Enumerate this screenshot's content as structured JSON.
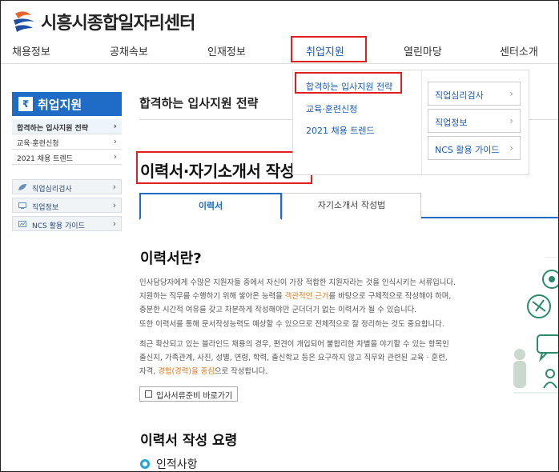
{
  "site": {
    "name": "시흥시종합일자리센터"
  },
  "gnb": [
    "채용정보",
    "공채속보",
    "인재정보",
    "취업지원",
    "열린마당",
    "센터소개"
  ],
  "dropdown": {
    "links": [
      "합격하는 입사지원 전략",
      "교육·훈련신청",
      "2021 채용 트렌드"
    ],
    "boxes": [
      "직업심리검사",
      "직업정보",
      "NCS 활용 가이드"
    ]
  },
  "sidebar": {
    "title": "취업지원",
    "items": [
      "합격하는 입사지원 전략",
      "교육·훈련신청",
      "2021 채용 트렌드"
    ],
    "subs": [
      "직업심리검사",
      "직업정보",
      "NCS 활용 가이드"
    ]
  },
  "main": {
    "sub_title": "합격하는 입사지원 전략",
    "page_title": "이력서·자기소개서 작성",
    "tabs": [
      "이력서",
      "자기소개서 작성법"
    ],
    "section_title": "이력서란?",
    "p1": {
      "l1": "인사담당자에게 수많은 지원자들 중에서 자신이 가장 적합한 지원자라는 것을 인식시키는 서류입니다.",
      "l2a": "지원하는 직무를 수행하기 위해 쌓아온 능력을 ",
      "l2h": "객관적인 근거",
      "l2b": "를 바탕으로 구체적으로 작성해야 하며,",
      "l3": "충분한 시간적 여유를 갖고 차분하게 작성해야만 군더더기 없는 이력서가 될 수 있습니다.",
      "l4": "또한 이력서를 통해 문서작성능력도 예상할 수 있으므로 전체적으로 잘 정리하는 것도 중요합니다."
    },
    "p2": {
      "l1": "최근 확산되고 있는 블라인드 채용의 경우, 편견이 개입되어 불합리한 차별을 야기할 수 있는 항목인",
      "l2": "출신지, 가족관계, 사진, 성별, 연령, 학력, 출신학교 등은 요구하지 않고 직무와 관련된 교육 · 훈련,",
      "l3a": "자격, ",
      "l3h": "경험(경력)을 중심",
      "l3b": "으로 작성합니다."
    },
    "link_button": "입사서류준비 바로가기",
    "section_title2": "이력서 작성 요령",
    "bullet_title": "인적사항"
  },
  "colors": {
    "accent": "#1e6cc6",
    "highlight": "#e07a1f",
    "annotation": "#e02020"
  }
}
